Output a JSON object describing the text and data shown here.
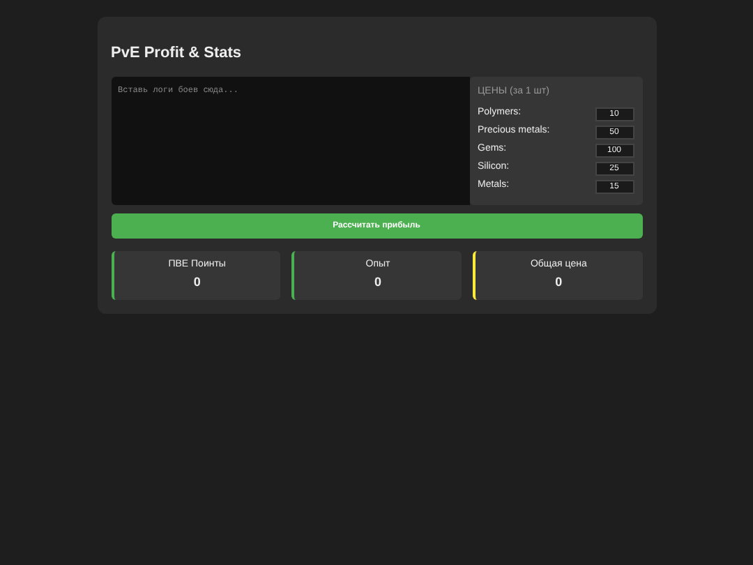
{
  "title": "PvE Profit & Stats",
  "log": {
    "placeholder": "Вставь логи боев сюда..."
  },
  "prices": {
    "title": "ЦЕНЫ (за 1 шт)",
    "items": [
      {
        "label": "Polymers:",
        "value": "10"
      },
      {
        "label": "Precious metals:",
        "value": "50"
      },
      {
        "label": "Gems:",
        "value": "100"
      },
      {
        "label": "Silicon:",
        "value": "25"
      },
      {
        "label": "Metals:",
        "value": "15"
      }
    ]
  },
  "button": "Рассчитать прибыль",
  "stats": [
    {
      "label": "ПВЕ Поинты",
      "value": "0",
      "color": "#4caf50"
    },
    {
      "label": "Опыт",
      "value": "0",
      "color": "#4caf50"
    },
    {
      "label": "Общая цена",
      "value": "0",
      "color": "#ffeb3b"
    }
  ]
}
